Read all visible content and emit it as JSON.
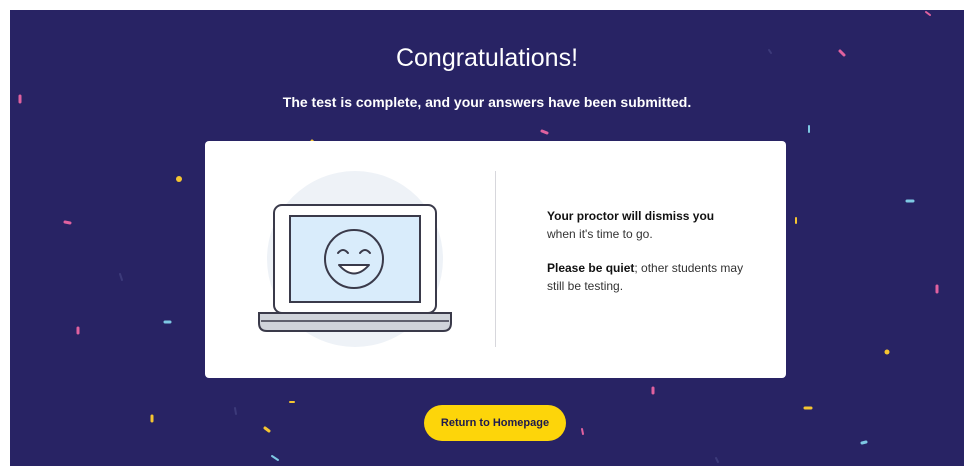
{
  "page": {
    "title": "Congratulations!",
    "subtitle": "The test is complete, and your answers have been submitted."
  },
  "card": {
    "message_1_bold": "Your proctor will dismiss you",
    "message_1_rest": "when it's time to go.",
    "message_2_bold": "Please be quiet",
    "message_2_rest": "; other students may still be testing."
  },
  "actions": {
    "return_label": "Return to Homepage"
  },
  "colors": {
    "background": "#282364",
    "card": "#ffffff",
    "button": "#fdd50a",
    "confetti_yellow": "#f5c531",
    "confetti_pink": "#e0619f",
    "confetti_blue": "#7ec8e3"
  },
  "icons": {
    "illustration": "laptop-smiley-icon"
  }
}
